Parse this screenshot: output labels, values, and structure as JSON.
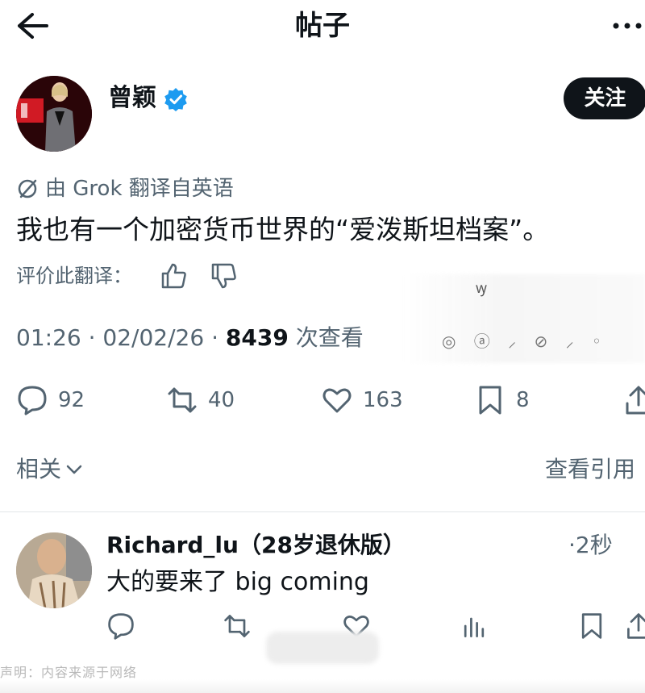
{
  "header": {
    "title": "帖子",
    "back_icon": "arrow-left-icon",
    "more_icon": "more-horizontal-icon"
  },
  "author": {
    "name": "曾颖",
    "verified": true,
    "follow_label": "关注"
  },
  "translation": {
    "note": "由 Grok 翻译自英语",
    "rate_label": "评价此翻译："
  },
  "post": {
    "text": "我也有一个加密货币世界的“爱泼斯坦档案”。"
  },
  "meta": {
    "time": "01:26",
    "date": "02/02/26",
    "views": "8439",
    "views_suffix": "次查看"
  },
  "actions": {
    "replies": "92",
    "reposts": "40",
    "likes": "163",
    "bookmarks": "8"
  },
  "related": {
    "label": "相关",
    "view_quotes": "查看引用"
  },
  "reply": {
    "name": "Richard_lu（28岁退休版）",
    "time": "·2秒",
    "text": "大的要来了 big coming"
  },
  "footer": {
    "note": "声明：内容来源于网络"
  },
  "colors": {
    "text": "#0f1419",
    "secondary": "#536471",
    "verified_blue": "#1d9bf0",
    "follow_bg": "#0f1419"
  }
}
